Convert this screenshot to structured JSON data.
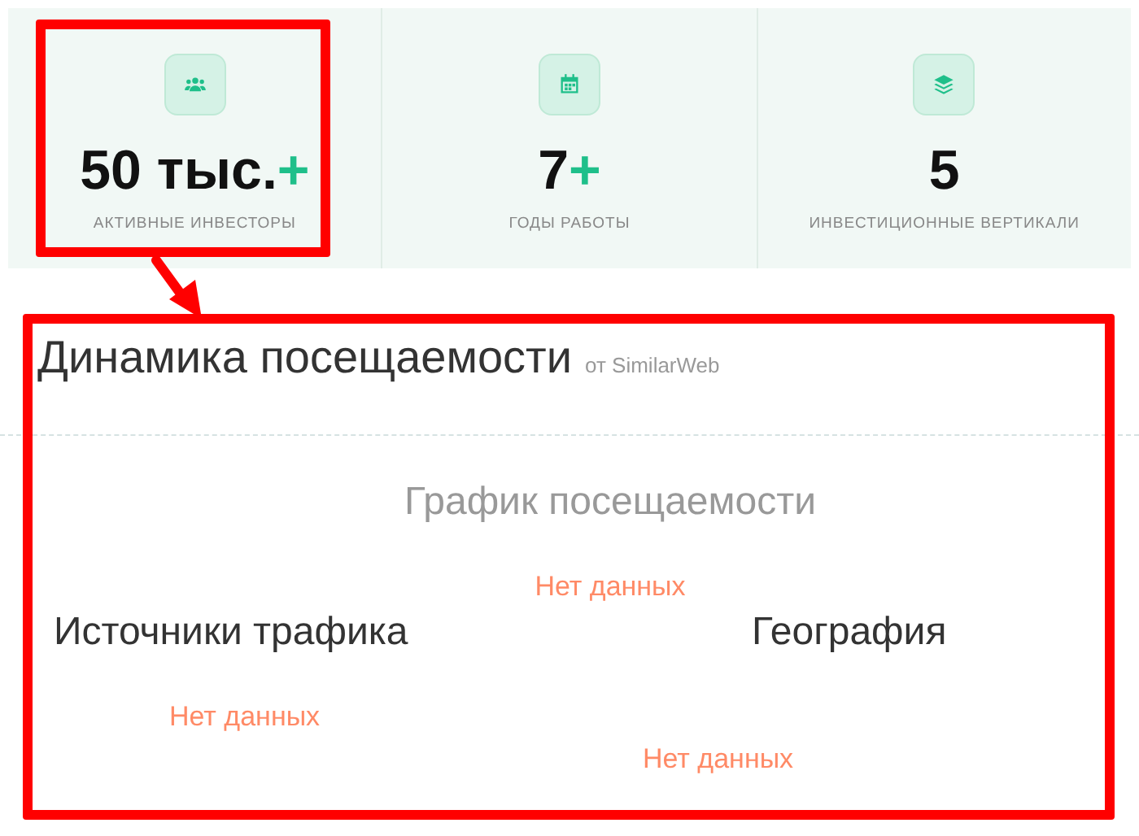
{
  "stats": [
    {
      "value": "50 тыс.",
      "suffix": "+",
      "label": "АКТИВНЫЕ ИНВЕСТОРЫ"
    },
    {
      "value": "7",
      "suffix": "+",
      "label": "ГОДЫ РАБОТЫ"
    },
    {
      "value": "5",
      "label": "ИНВЕСТИЦИОННЫЕ ВЕРТИКАЛИ"
    }
  ],
  "traffic": {
    "title": "Динамика посещаемости",
    "source": "от SimilarWeb",
    "chart": {
      "title": "График посещаемости",
      "empty": "Нет данных"
    },
    "sources": {
      "title": "Источники трафика",
      "empty": "Нет данных"
    },
    "geography": {
      "title": "География",
      "empty": "Нет данных"
    }
  }
}
